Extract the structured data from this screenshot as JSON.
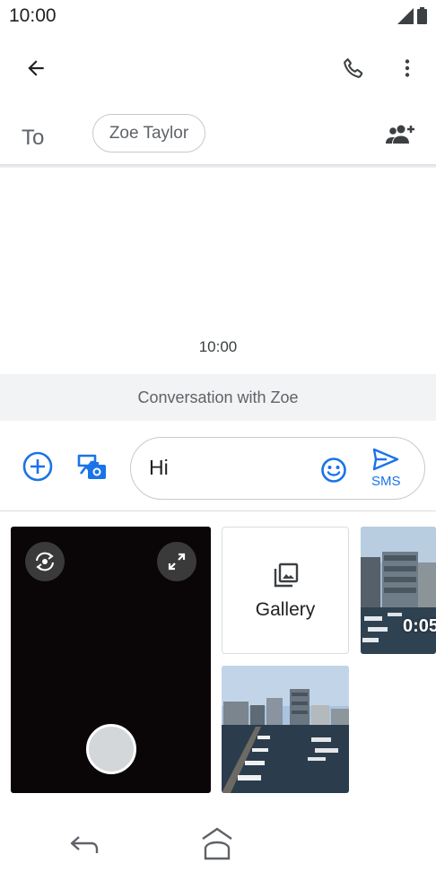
{
  "status_bar": {
    "time": "10:00"
  },
  "recipient": {
    "to_label": "To",
    "chip_name": "Zoe Taylor"
  },
  "conversation": {
    "timestamp": "10:00",
    "banner": "Conversation with Zoe"
  },
  "compose": {
    "text": "Hi",
    "send_label": "SMS"
  },
  "media_picker": {
    "gallery_label": "Gallery",
    "video_duration": "0:05"
  },
  "colors": {
    "accent": "#1a73e8",
    "icon_gray": "#3c4043",
    "banner_bg": "#f1f3f4"
  }
}
